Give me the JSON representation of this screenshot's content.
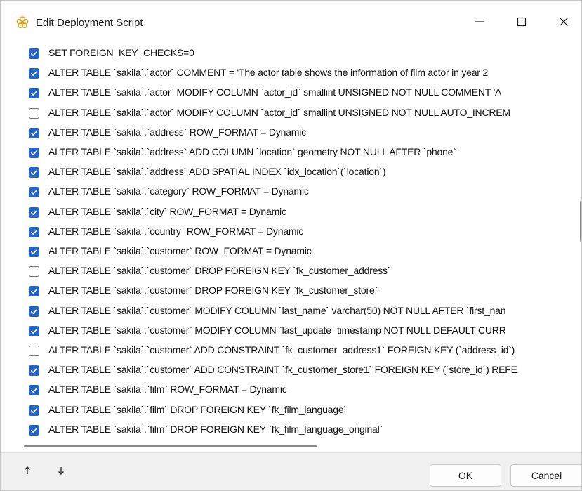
{
  "window": {
    "title": "Edit Deployment Script",
    "icon": "sakura-app-icon",
    "controls": {
      "minimize": "minimize-icon",
      "maximize": "maximize-icon",
      "close": "close-icon"
    }
  },
  "colors": {
    "checkbox_checked": "#2463c8",
    "checkbox_unchecked_border": "#707070",
    "footer_bg": "#f0f0f0"
  },
  "statements": [
    {
      "checked": true,
      "text": "SET FOREIGN_KEY_CHECKS=0"
    },
    {
      "checked": true,
      "text": "ALTER TABLE `sakila`.`actor` COMMENT = 'The actor table shows the information of film actor in year 2"
    },
    {
      "checked": true,
      "text": "ALTER TABLE `sakila`.`actor` MODIFY COLUMN `actor_id` smallint UNSIGNED NOT NULL COMMENT 'A"
    },
    {
      "checked": false,
      "text": "ALTER TABLE `sakila`.`actor` MODIFY COLUMN `actor_id` smallint UNSIGNED NOT NULL AUTO_INCREM"
    },
    {
      "checked": true,
      "text": "ALTER TABLE `sakila`.`address` ROW_FORMAT = Dynamic"
    },
    {
      "checked": true,
      "text": "ALTER TABLE `sakila`.`address` ADD COLUMN `location` geometry NOT NULL AFTER `phone`"
    },
    {
      "checked": true,
      "text": "ALTER TABLE `sakila`.`address` ADD SPATIAL INDEX `idx_location`(`location`)"
    },
    {
      "checked": true,
      "text": "ALTER TABLE `sakila`.`category` ROW_FORMAT = Dynamic"
    },
    {
      "checked": true,
      "text": "ALTER TABLE `sakila`.`city` ROW_FORMAT = Dynamic"
    },
    {
      "checked": true,
      "text": "ALTER TABLE `sakila`.`country` ROW_FORMAT = Dynamic"
    },
    {
      "checked": true,
      "text": "ALTER TABLE `sakila`.`customer` ROW_FORMAT = Dynamic"
    },
    {
      "checked": false,
      "text": "ALTER TABLE `sakila`.`customer` DROP FOREIGN KEY `fk_customer_address`"
    },
    {
      "checked": true,
      "text": "ALTER TABLE `sakila`.`customer` DROP FOREIGN KEY `fk_customer_store`"
    },
    {
      "checked": true,
      "text": "ALTER TABLE `sakila`.`customer` MODIFY COLUMN `last_name` varchar(50) NOT NULL AFTER `first_nan"
    },
    {
      "checked": true,
      "text": "ALTER TABLE `sakila`.`customer` MODIFY COLUMN `last_update` timestamp NOT NULL DEFAULT CURR"
    },
    {
      "checked": false,
      "text": "ALTER TABLE `sakila`.`customer` ADD CONSTRAINT `fk_customer_address1` FOREIGN KEY (`address_id`)"
    },
    {
      "checked": true,
      "text": "ALTER TABLE `sakila`.`customer` ADD CONSTRAINT `fk_customer_store1` FOREIGN KEY (`store_id`) REFE"
    },
    {
      "checked": true,
      "text": "ALTER TABLE `sakila`.`film` ROW_FORMAT = Dynamic"
    },
    {
      "checked": true,
      "text": "ALTER TABLE `sakila`.`film` DROP FOREIGN KEY `fk_film_language`"
    },
    {
      "checked": true,
      "text": "ALTER TABLE `sakila`.`film` DROP FOREIGN KEY `fk_film_language_original`"
    }
  ],
  "footer": {
    "move_up_icon": "arrow-up-icon",
    "move_down_icon": "arrow-down-icon",
    "ok_label": "OK",
    "cancel_label": "Cancel"
  }
}
